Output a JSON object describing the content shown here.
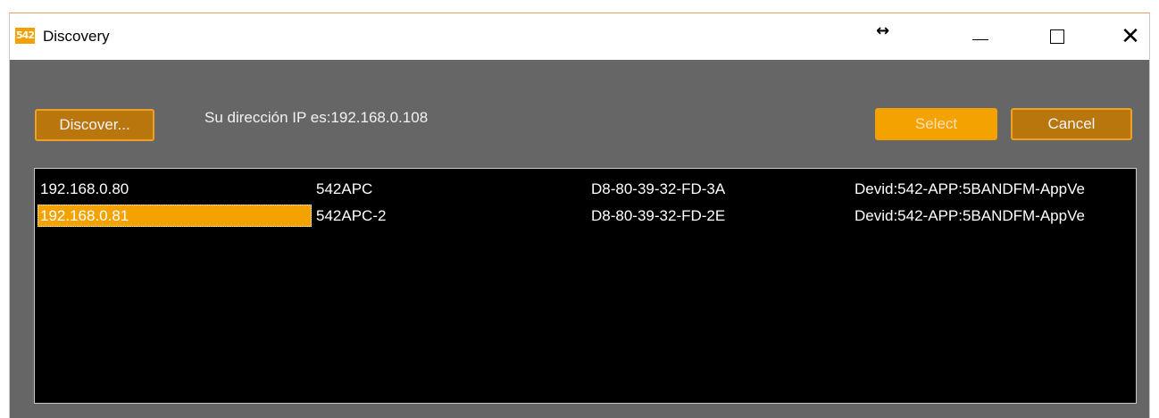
{
  "window": {
    "title": "Discovery",
    "app_icon_text": "542",
    "resize_glyph": "↔",
    "close_glyph": "✕"
  },
  "toolbar": {
    "discover_label": "Discover...",
    "ip_text": "Su dirección IP es:192.168.0.108",
    "select_label": "Select",
    "cancel_label": "Cancel"
  },
  "devices": [
    {
      "ip": "192.168.0.80",
      "name": "542APC",
      "mac": "D8-80-39-32-FD-3A",
      "devid": "Devid:542-APP:5BANDFM-AppVe",
      "selected": false
    },
    {
      "ip": "192.168.0.81",
      "name": "542APC-2",
      "mac": "D8-80-39-32-FD-2E",
      "devid": "Devid:542-APP:5BANDFM-AppVe",
      "selected": true
    }
  ],
  "colors": {
    "accent": "#f4a200",
    "button_dark": "#b8760d",
    "dialog_bg": "#666666",
    "list_bg": "#000000"
  }
}
